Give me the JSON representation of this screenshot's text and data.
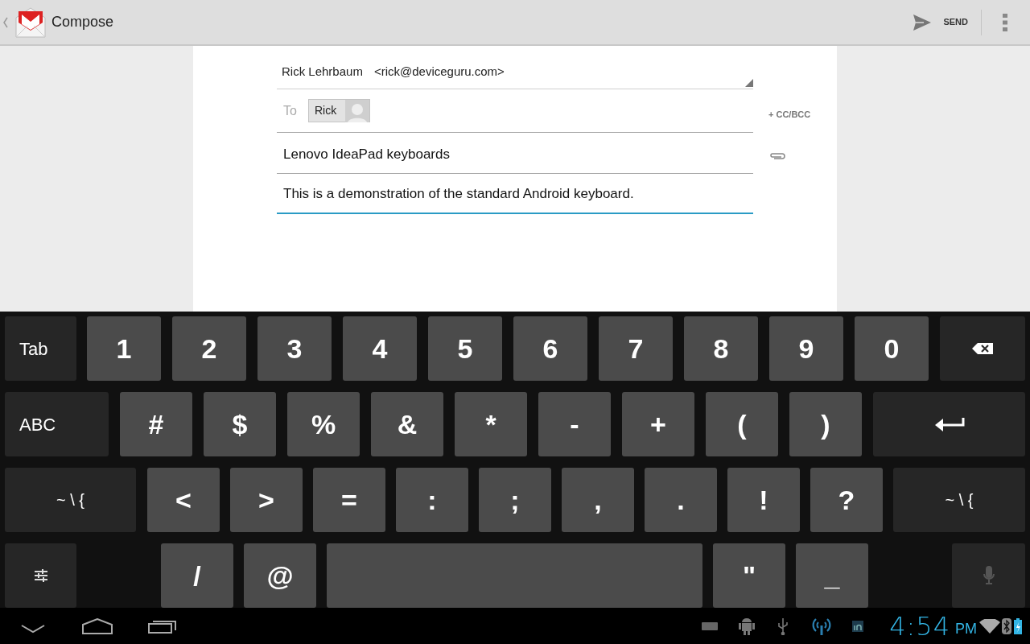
{
  "app_bar": {
    "title": "Compose",
    "send_label": "SEND"
  },
  "compose": {
    "from_name": "Rick Lehrbaum",
    "from_email": "<rick@deviceguru.com>",
    "to_label": "To",
    "recipients": [
      {
        "name": "Rick"
      }
    ],
    "cc_bcc": "+ CC/BCC",
    "subject": "Lenovo IdeaPad keyboards",
    "body": "This is a demonstration of the standard Android keyboard.",
    "body_focused": true
  },
  "keyboard": {
    "rows": [
      [
        {
          "kind": "function",
          "label": "Tab"
        },
        {
          "kind": "char",
          "label": "1"
        },
        {
          "kind": "char",
          "label": "2"
        },
        {
          "kind": "char",
          "label": "3"
        },
        {
          "kind": "char",
          "label": "4"
        },
        {
          "kind": "char",
          "label": "5"
        },
        {
          "kind": "char",
          "label": "6"
        },
        {
          "kind": "char",
          "label": "7"
        },
        {
          "kind": "char",
          "label": "8"
        },
        {
          "kind": "char",
          "label": "9"
        },
        {
          "kind": "char",
          "label": "0"
        },
        {
          "kind": "backspace"
        }
      ],
      [
        {
          "kind": "function",
          "label": "ABC"
        },
        {
          "kind": "char",
          "label": "#"
        },
        {
          "kind": "char",
          "label": "$"
        },
        {
          "kind": "char",
          "label": "%"
        },
        {
          "kind": "char",
          "label": "&"
        },
        {
          "kind": "char",
          "label": "*"
        },
        {
          "kind": "char",
          "label": "-"
        },
        {
          "kind": "char",
          "label": "+"
        },
        {
          "kind": "char",
          "label": "("
        },
        {
          "kind": "char",
          "label": ")"
        },
        {
          "kind": "enter"
        }
      ],
      [
        {
          "kind": "function",
          "label": "~ \\ {"
        },
        {
          "kind": "char",
          "label": "<"
        },
        {
          "kind": "char",
          "label": ">"
        },
        {
          "kind": "char",
          "label": "="
        },
        {
          "kind": "char",
          "label": ":"
        },
        {
          "kind": "char",
          "label": ";"
        },
        {
          "kind": "char",
          "label": ","
        },
        {
          "kind": "char",
          "label": "."
        },
        {
          "kind": "char",
          "label": "!"
        },
        {
          "kind": "char",
          "label": "?"
        },
        {
          "kind": "function",
          "label": "~ \\ {"
        }
      ],
      [
        {
          "kind": "settings"
        },
        {
          "kind": "char",
          "label": "/"
        },
        {
          "kind": "char",
          "label": "@"
        },
        {
          "kind": "space"
        },
        {
          "kind": "char",
          "label": "\""
        },
        {
          "kind": "char",
          "label": "_"
        },
        {
          "kind": "mic"
        }
      ]
    ]
  },
  "status_bar": {
    "time": "4:54",
    "am_pm": "PM"
  }
}
